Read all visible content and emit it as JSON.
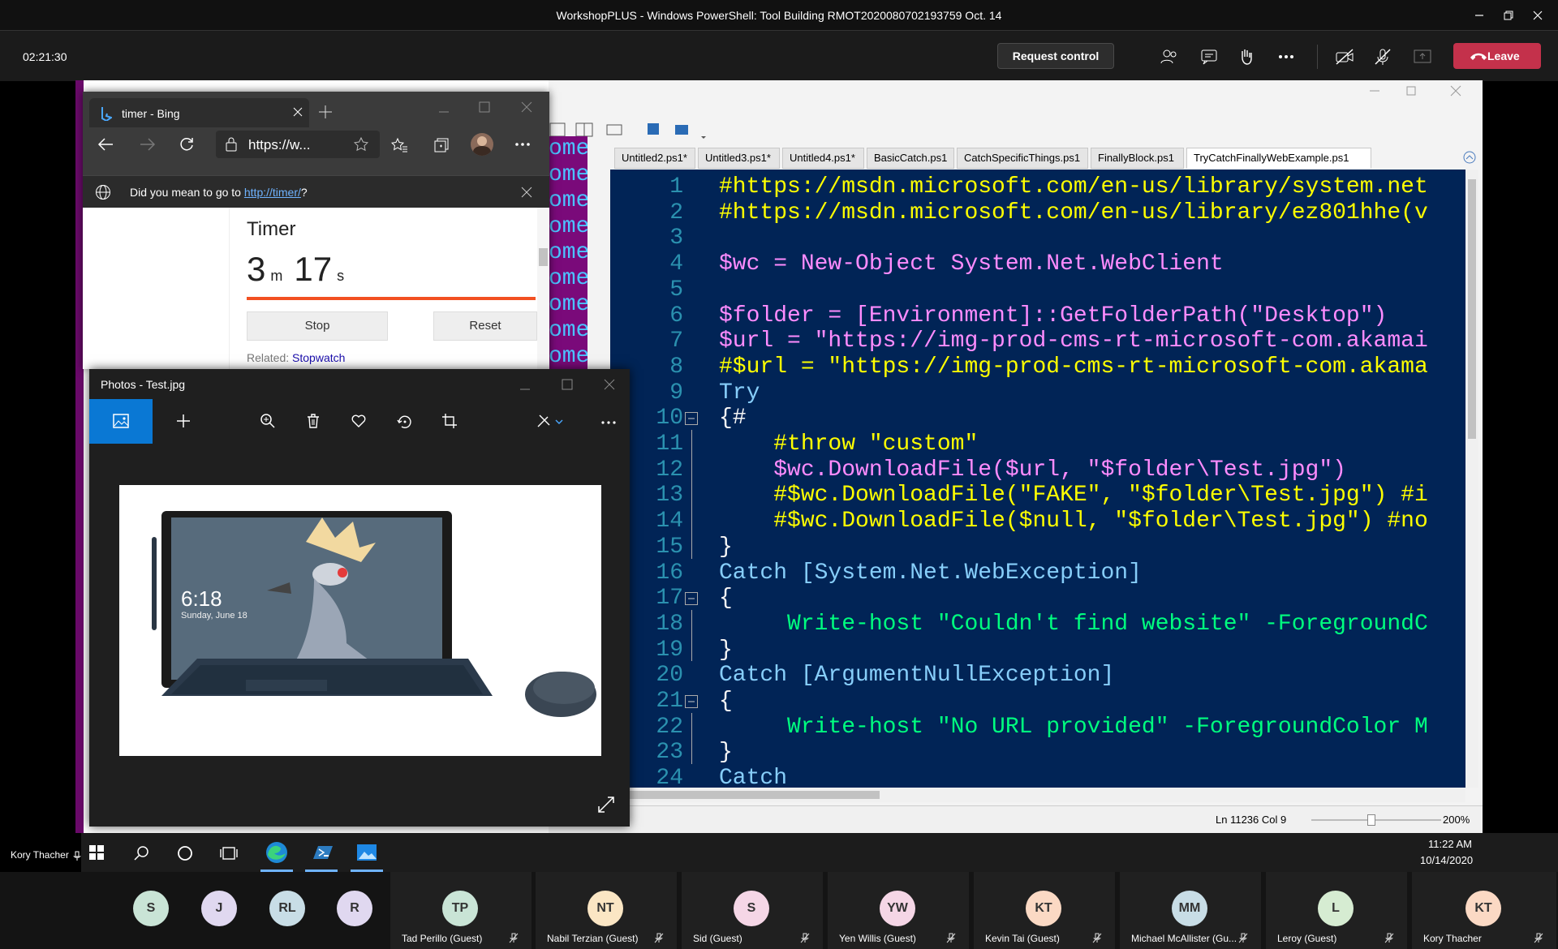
{
  "teams": {
    "title": "WorkshopPLUS - Windows PowerShell: Tool Building RMOT2020080702193759 Oct. 14",
    "elapsed": "02:21:30",
    "request_control": "Request control",
    "leave": "Leave",
    "presenter": "Kory Thacher"
  },
  "ise": {
    "tabs": [
      "Untitled2.ps1*",
      "Untitled3.ps1*",
      "Untitled4.ps1*",
      "BasicCatch.ps1",
      "CatchSpecificThings.ps1",
      "FinallyBlock.ps1",
      "TryCatchFinallyWebExample.ps1"
    ],
    "status_position": "Ln 11236  Col 9",
    "zoom": "200%",
    "behind_text": "ome",
    "code": [
      {
        "n": "1",
        "t": "#https://msdn.microsoft.com/en-us/library/system.net"
      },
      {
        "n": "2",
        "t": "#https://msdn.microsoft.com/en-us/library/ez801hhe(v"
      },
      {
        "n": "3",
        "t": ""
      },
      {
        "n": "4",
        "t": "$wc = New-Object System.Net.WebClient"
      },
      {
        "n": "5",
        "t": ""
      },
      {
        "n": "6",
        "t": "$folder = [Environment]::GetFolderPath(\"Desktop\")"
      },
      {
        "n": "7",
        "t": "$url = \"https://img-prod-cms-rt-microsoft-com.akamai"
      },
      {
        "n": "8",
        "t": "#$url = \"https://img-prod-cms-rt-microsoft-com.akama"
      },
      {
        "n": "9",
        "t": "Try"
      },
      {
        "n": "10",
        "t": "{#"
      },
      {
        "n": "11",
        "t": "    #throw \"custom\""
      },
      {
        "n": "12",
        "t": "    $wc.DownloadFile($url, \"$folder\\Test.jpg\")"
      },
      {
        "n": "13",
        "t": "    #$wc.DownloadFile(\"FAKE\", \"$folder\\Test.jpg\") #i"
      },
      {
        "n": "14",
        "t": "    #$wc.DownloadFile($null, \"$folder\\Test.jpg\") #no"
      },
      {
        "n": "15",
        "t": "}"
      },
      {
        "n": "16",
        "t": "Catch [System.Net.WebException]"
      },
      {
        "n": "17",
        "t": "{"
      },
      {
        "n": "18",
        "t": "     Write-host \"Couldn't find website\" -ForegroundC"
      },
      {
        "n": "19",
        "t": "}"
      },
      {
        "n": "20",
        "t": "Catch [ArgumentNullException]"
      },
      {
        "n": "21",
        "t": "{"
      },
      {
        "n": "22",
        "t": "     Write-host \"No URL provided\" -ForegroundColor M"
      },
      {
        "n": "23",
        "t": "}"
      },
      {
        "n": "24",
        "t": "Catch"
      }
    ]
  },
  "browser": {
    "tab_title": "timer - Bing",
    "url": "https://w...",
    "suggest_prefix": "Did you mean to go to ",
    "suggest_link": "http://timer/",
    "suggest_suffix": "?",
    "timer_title": "Timer",
    "minutes": "3",
    "min_unit": "m",
    "seconds": "17",
    "sec_unit": "s",
    "stop": "Stop",
    "reset": "Reset",
    "related_label": "Related:",
    "related_link": "Stopwatch"
  },
  "photos": {
    "title": "Photos - Test.jpg",
    "device_time": "6:18",
    "device_date": "Sunday, June 18"
  },
  "taskbar": {
    "time": "11:22 AM",
    "date": "10/14/2020"
  },
  "participants_avatars": [
    {
      "initials": "S",
      "color": "#c9e4d6"
    },
    {
      "initials": "J",
      "color": "#e0d8f0"
    },
    {
      "initials": "RL",
      "color": "#c8dde6"
    },
    {
      "initials": "R",
      "color": "#e0d8f0"
    }
  ],
  "participants_tiles": [
    {
      "initials": "TP",
      "name": "Tad Perillo (Guest)",
      "color": "#c9e4d6"
    },
    {
      "initials": "NT",
      "name": "Nabil Terzian (Guest)",
      "color": "#fbe6c4"
    },
    {
      "initials": "S",
      "name": "Sid (Guest)",
      "color": "#f5d6e6"
    },
    {
      "initials": "YW",
      "name": "Yen Willis (Guest)",
      "color": "#f5d6e6"
    },
    {
      "initials": "KT",
      "name": "Kevin Tai (Guest)",
      "color": "#fbd9c4"
    },
    {
      "initials": "MM",
      "name": "Michael McAllister (Gu...",
      "color": "#c8dde6"
    },
    {
      "initials": "L",
      "name": "Leroy (Guest)",
      "color": "#d6ecd2"
    },
    {
      "initials": "KT",
      "name": "Kory Thacher",
      "color": "#fbd9c4"
    }
  ]
}
